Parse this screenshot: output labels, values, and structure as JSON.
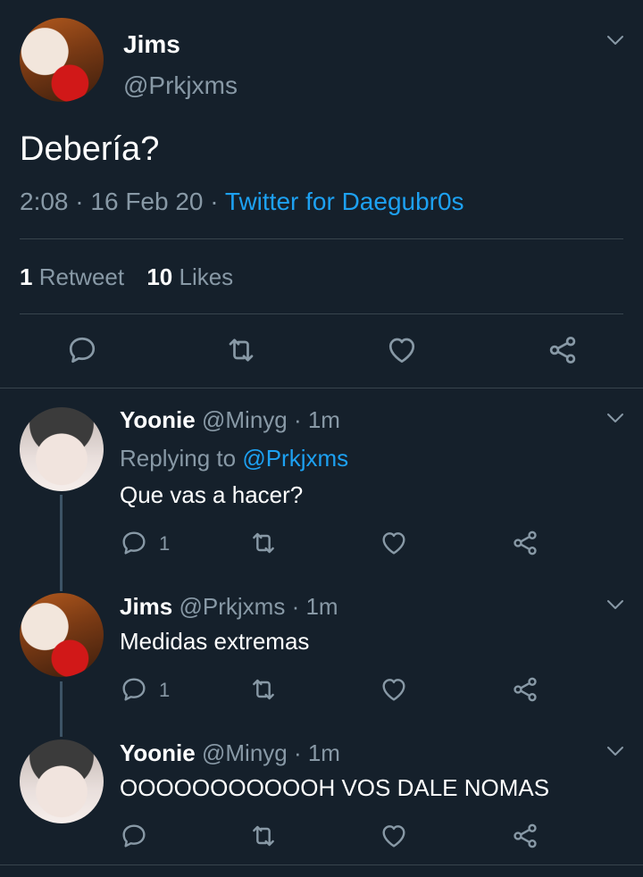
{
  "main_tweet": {
    "display_name": "Jims",
    "handle": "@Prkjxms",
    "text": "Debería?",
    "time": "2:08",
    "date": "16 Feb 20",
    "sep": "·",
    "source": "Twitter for Daegubr0s",
    "retweet_count": "1",
    "retweet_label": "Retweet",
    "like_count": "10",
    "like_label": "Likes"
  },
  "replies": [
    {
      "display_name": "Yoonie",
      "handle": "@Minyg",
      "meta": "· 1m",
      "replying_label": "Replying to",
      "replying_handle": "@Prkjxms",
      "text": "Que vas a hacer?",
      "reply_count": "1"
    },
    {
      "display_name": "Jims",
      "handle": "@Prkjxms",
      "meta": "· 1m",
      "text": "Medidas extremas",
      "reply_count": "1"
    },
    {
      "display_name": "Yoonie",
      "handle": "@Minyg",
      "meta": "· 1m",
      "text": "OOOOOOOOOOOH VOS DALE NOMAS",
      "reply_count": ""
    }
  ],
  "icons": {
    "reply": "reply-icon",
    "retweet": "retweet-icon",
    "like": "heart-icon",
    "share": "share-icon",
    "more": "chevron-down-icon"
  },
  "colors": {
    "background": "#15202b",
    "text": "#ffffff",
    "muted": "#8899a6",
    "link": "#1da1f2",
    "divider": "#38444d"
  }
}
